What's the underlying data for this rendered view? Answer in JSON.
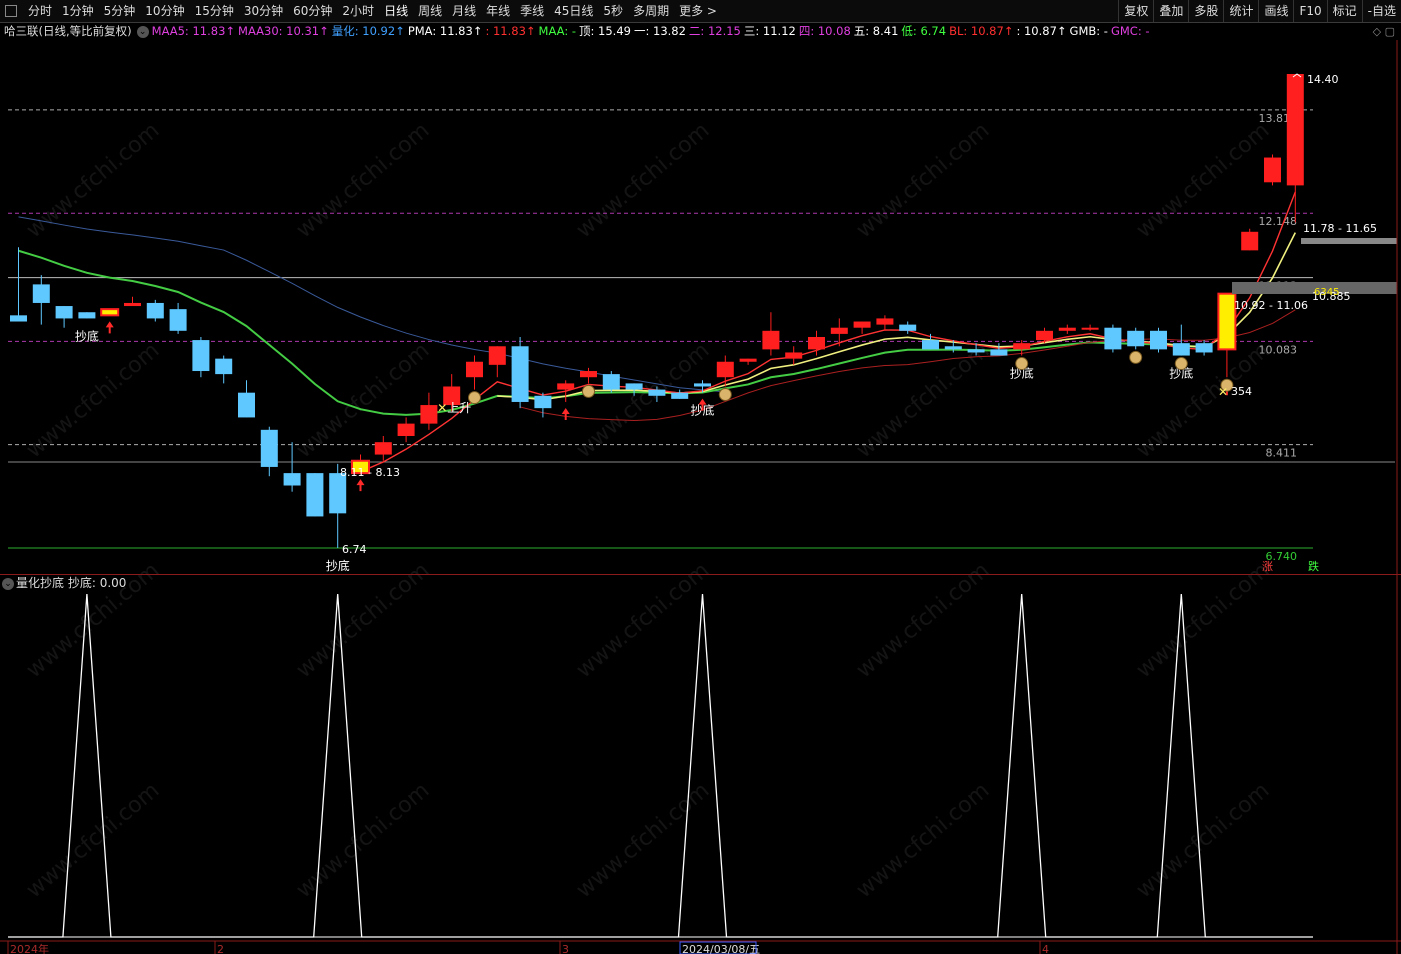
{
  "toolbar": {
    "periods": [
      "分时",
      "1分钟",
      "5分钟",
      "10分钟",
      "15分钟",
      "30分钟",
      "60分钟",
      "2小时",
      "日线",
      "周线",
      "月线",
      "年线",
      "季线",
      "45日线",
      "5秒",
      "多周期",
      "更多 >"
    ],
    "active_period": "日线",
    "right_buttons": [
      "复权",
      "叠加",
      "多股",
      "统计",
      "画线",
      "F10",
      "标记",
      "-自选"
    ]
  },
  "info": {
    "stock": "哈三联(日线,等比前复权)",
    "items": [
      {
        "text": "MAA5: 11.83↑",
        "color": "#e040e0"
      },
      {
        "text": "MAA30: 10.31↑",
        "color": "#e040e0"
      },
      {
        "text": "量化: 10.92↑",
        "color": "#40a0ff"
      },
      {
        "text": "PMA: 11.83↑",
        "color": "#ffffff"
      },
      {
        "text": ": 11.83↑",
        "color": "#ff3030"
      },
      {
        "text": "MAA: -",
        "color": "#40ff40"
      },
      {
        "text": "顶: 15.49",
        "color": "#ffffff"
      },
      {
        "text": "一: 13.82",
        "color": "#ffffff"
      },
      {
        "text": "二: 12.15",
        "color": "#e040e0"
      },
      {
        "text": "三: 11.12",
        "color": "#ffffff"
      },
      {
        "text": "四: 10.08",
        "color": "#e040e0"
      },
      {
        "text": "五: 8.41",
        "color": "#ffffff"
      },
      {
        "text": "低: 6.74",
        "color": "#40ff40"
      },
      {
        "text": "BL: 10.87↑",
        "color": "#ff3030"
      },
      {
        "text": ": 10.87↑",
        "color": "#ffffff"
      },
      {
        "text": "GMB: -",
        "color": "#ffffff"
      },
      {
        "text": "GMC: -",
        "color": "#e040e0"
      }
    ],
    "window_icons": "◇ ▢"
  },
  "price_levels": [
    {
      "label": "13.819",
      "price": 13.82,
      "color": "#cccccc",
      "style": "dash"
    },
    {
      "label": "12.148",
      "price": 12.15,
      "color": "#cc44cc",
      "style": "dash"
    },
    {
      "label": "11.113",
      "price": 11.11,
      "color": "#dddddd",
      "style": "solid"
    },
    {
      "label": "10.083",
      "price": 10.08,
      "color": "#cc44cc",
      "style": "dash"
    },
    {
      "label": "8.411",
      "price": 8.41,
      "color": "#cccccc",
      "style": "dash"
    },
    {
      "label": "6.740",
      "price": 6.74,
      "color": "#33cc33",
      "style": "solid"
    }
  ],
  "annotations": {
    "high_label": "14.40",
    "range_top": "11.78 - 11.65",
    "range_mid": "10.92 - 11.06",
    "range_low": "8.11 - 8.13",
    "low_label": "6.74",
    "right_val1": "10.885",
    "right_val2": "6345",
    "cross_val": "354",
    "rise": "涨",
    "fall": "跌"
  },
  "signals": {
    "dip": "抄底",
    "up": "上升"
  },
  "indicator": {
    "name": "量化抄底",
    "value_label": "抄底: 0.00"
  },
  "date_axis": [
    "2024年",
    "2",
    "3",
    "2024/03/08/五",
    "4"
  ],
  "watermark": "www.cfchi.com",
  "chart_data": {
    "type": "candlestick",
    "ylim": [
      6.5,
      14.6
    ],
    "candles": [
      {
        "o": 10.5,
        "c": 10.4,
        "h": 11.6,
        "l": 10.4
      },
      {
        "o": 11.0,
        "c": 10.7,
        "h": 11.15,
        "l": 10.35
      },
      {
        "o": 10.65,
        "c": 10.45,
        "h": 10.65,
        "l": 10.3
      },
      {
        "o": 10.55,
        "c": 10.45,
        "h": 10.55,
        "l": 10.45
      },
      {
        "o": 10.5,
        "c": 10.6,
        "h": 10.6,
        "l": 10.5
      },
      {
        "o": 10.65,
        "c": 10.7,
        "h": 10.8,
        "l": 10.65
      },
      {
        "o": 10.7,
        "c": 10.45,
        "h": 10.75,
        "l": 10.4
      },
      {
        "o": 10.6,
        "c": 10.25,
        "h": 10.7,
        "l": 10.2
      },
      {
        "o": 10.1,
        "c": 9.6,
        "h": 10.15,
        "l": 9.5
      },
      {
        "o": 9.8,
        "c": 9.55,
        "h": 9.85,
        "l": 9.4
      },
      {
        "o": 9.25,
        "c": 8.85,
        "h": 9.45,
        "l": 8.85
      },
      {
        "o": 8.65,
        "c": 8.05,
        "h": 8.7,
        "l": 7.9
      },
      {
        "o": 7.95,
        "c": 7.75,
        "h": 8.45,
        "l": 7.65
      },
      {
        "o": 7.95,
        "c": 7.25,
        "h": 7.95,
        "l": 7.25
      },
      {
        "o": 7.95,
        "c": 7.3,
        "h": 8.1,
        "l": 6.74
      },
      {
        "o": 7.95,
        "c": 8.15,
        "h": 8.25,
        "l": 7.95
      },
      {
        "o": 8.25,
        "c": 8.45,
        "h": 8.55,
        "l": 8.15
      },
      {
        "o": 8.55,
        "c": 8.75,
        "h": 8.85,
        "l": 8.45
      },
      {
        "o": 8.75,
        "c": 9.05,
        "h": 9.25,
        "l": 8.65
      },
      {
        "o": 9.05,
        "c": 9.35,
        "h": 9.55,
        "l": 8.95
      },
      {
        "o": 9.5,
        "c": 9.75,
        "h": 9.85,
        "l": 9.3
      },
      {
        "o": 9.7,
        "c": 10.0,
        "h": 10.0,
        "l": 9.5
      },
      {
        "o": 10.0,
        "c": 9.1,
        "h": 10.15,
        "l": 9.0
      },
      {
        "o": 9.2,
        "c": 9.0,
        "h": 9.25,
        "l": 8.85
      },
      {
        "o": 9.3,
        "c": 9.4,
        "h": 9.45,
        "l": 9.1
      },
      {
        "o": 9.5,
        "c": 9.6,
        "h": 9.65,
        "l": 9.4
      },
      {
        "o": 9.55,
        "c": 9.3,
        "h": 9.6,
        "l": 9.25
      },
      {
        "o": 9.4,
        "c": 9.3,
        "h": 9.4,
        "l": 9.2
      },
      {
        "o": 9.3,
        "c": 9.2,
        "h": 9.35,
        "l": 9.1
      },
      {
        "o": 9.25,
        "c": 9.15,
        "h": 9.3,
        "l": 9.15
      },
      {
        "o": 9.4,
        "c": 9.35,
        "h": 9.45,
        "l": 9.25
      },
      {
        "o": 9.5,
        "c": 9.75,
        "h": 9.85,
        "l": 9.35
      },
      {
        "o": 9.75,
        "c": 9.8,
        "h": 9.8,
        "l": 9.7
      },
      {
        "o": 9.95,
        "c": 10.25,
        "h": 10.55,
        "l": 9.85
      },
      {
        "o": 9.8,
        "c": 9.9,
        "h": 10.0,
        "l": 9.7
      },
      {
        "o": 9.95,
        "c": 10.15,
        "h": 10.25,
        "l": 9.85
      },
      {
        "o": 10.2,
        "c": 10.3,
        "h": 10.45,
        "l": 10.0
      },
      {
        "o": 10.3,
        "c": 10.4,
        "h": 10.4,
        "l": 10.2
      },
      {
        "o": 10.35,
        "c": 10.45,
        "h": 10.5,
        "l": 10.25
      },
      {
        "o": 10.35,
        "c": 10.25,
        "h": 10.4,
        "l": 10.2
      },
      {
        "o": 10.1,
        "c": 9.95,
        "h": 10.2,
        "l": 9.95
      },
      {
        "o": 10.0,
        "c": 9.95,
        "h": 10.1,
        "l": 9.9
      },
      {
        "o": 9.95,
        "c": 9.9,
        "h": 10.05,
        "l": 9.85
      },
      {
        "o": 9.95,
        "c": 9.85,
        "h": 10.05,
        "l": 9.85
      },
      {
        "o": 9.95,
        "c": 10.05,
        "h": 10.1,
        "l": 9.85
      },
      {
        "o": 10.1,
        "c": 10.25,
        "h": 10.3,
        "l": 10.05
      },
      {
        "o": 10.25,
        "c": 10.3,
        "h": 10.35,
        "l": 10.2
      },
      {
        "o": 10.3,
        "c": 10.3,
        "h": 10.35,
        "l": 10.25
      },
      {
        "o": 10.3,
        "c": 9.95,
        "h": 10.35,
        "l": 9.9
      },
      {
        "o": 10.25,
        "c": 10.0,
        "h": 10.3,
        "l": 9.95
      },
      {
        "o": 10.25,
        "c": 9.95,
        "h": 10.3,
        "l": 9.9
      },
      {
        "o": 10.05,
        "c": 9.85,
        "h": 10.35,
        "l": 9.85
      },
      {
        "o": 10.05,
        "c": 9.9,
        "h": 10.1,
        "l": 9.85
      },
      {
        "o": 9.95,
        "c": 10.85,
        "h": 10.85,
        "l": 9.5
      },
      {
        "o": 11.55,
        "c": 11.85,
        "h": 11.9,
        "l": 11.55
      },
      {
        "o": 12.65,
        "c": 13.05,
        "h": 13.1,
        "l": 12.6
      },
      {
        "o": 12.6,
        "c": 14.4,
        "h": 14.4,
        "l": 12.0
      }
    ]
  }
}
